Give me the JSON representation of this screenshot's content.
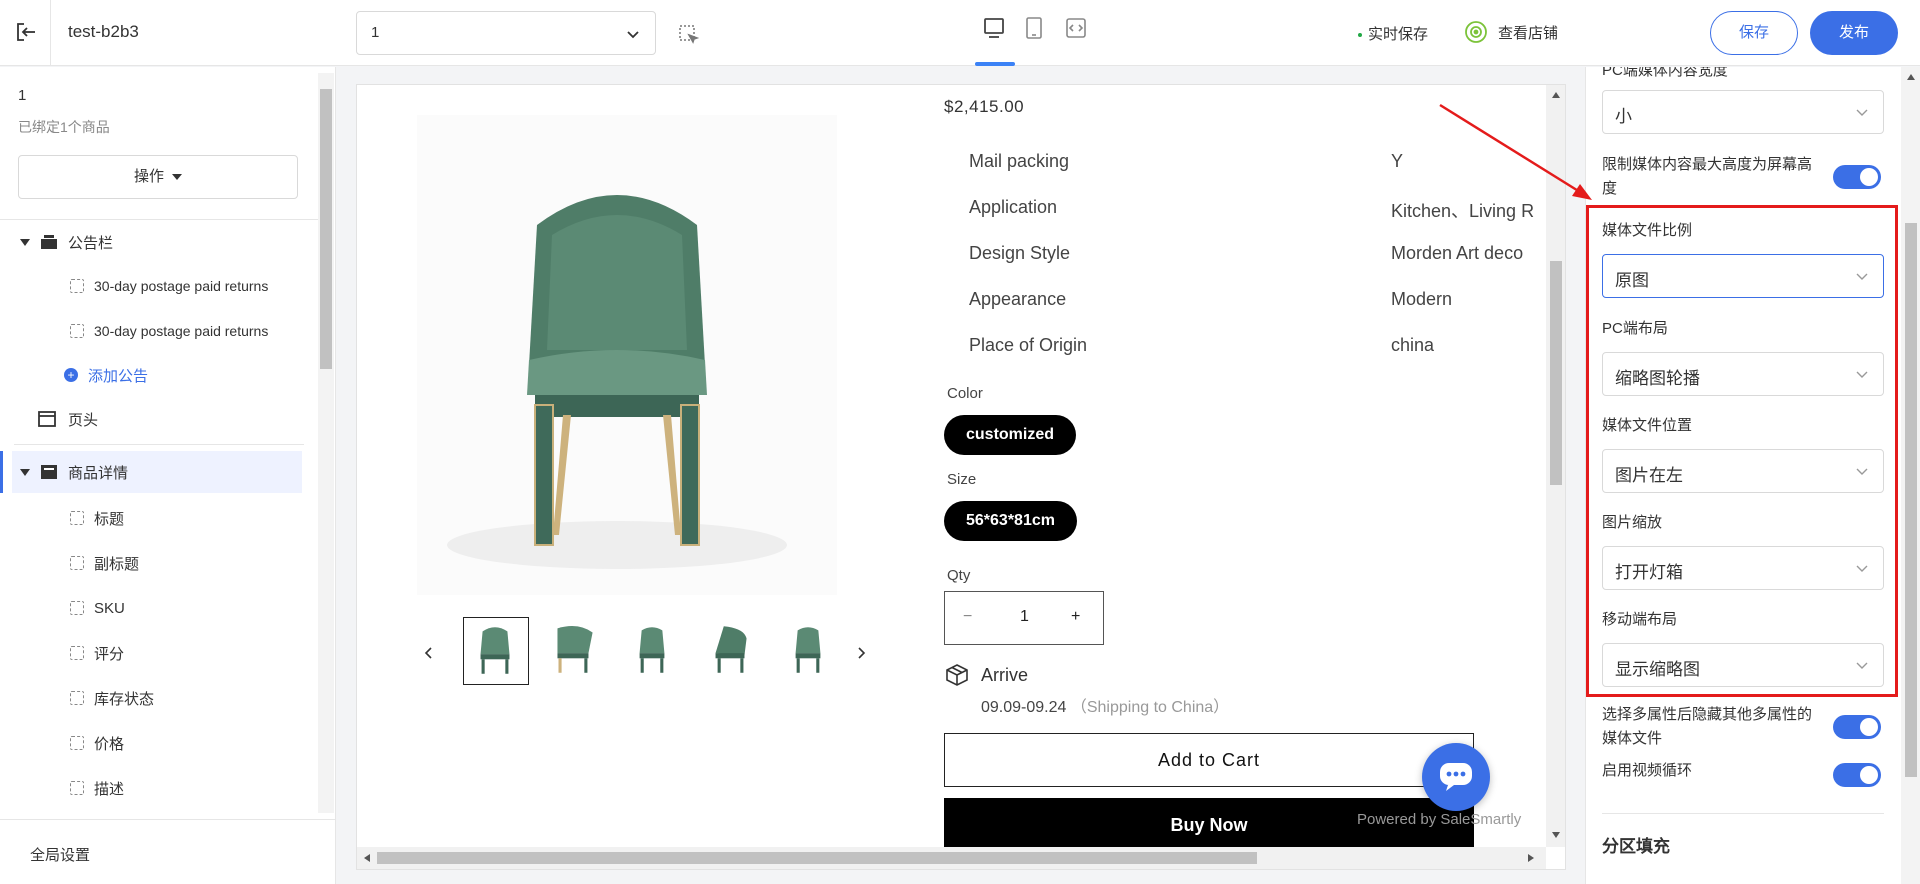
{
  "topbar": {
    "store_name": "test-b2b3",
    "page_select": "1",
    "autosave": "实时保存",
    "view_store": "查看店铺",
    "save": "保存",
    "publish": "发布"
  },
  "left": {
    "title": "1",
    "subtitle": "已绑定1个商品",
    "op_button": "操作",
    "tree": [
      {
        "label": "公告栏"
      },
      {
        "label": "30-day postage paid returns"
      },
      {
        "label": "30-day postage paid returns"
      },
      {
        "label": "添加公告"
      },
      {
        "label": "页头"
      },
      {
        "label": "商品详情"
      },
      {
        "label": "标题"
      },
      {
        "label": "副标题"
      },
      {
        "label": "SKU"
      },
      {
        "label": "评分"
      },
      {
        "label": "库存状态"
      },
      {
        "label": "价格"
      },
      {
        "label": "描述"
      }
    ],
    "global_settings": "全局设置"
  },
  "product": {
    "price": "$2,415.00",
    "specs": [
      {
        "key": "Mail packing",
        "value": "Y"
      },
      {
        "key": "Application",
        "value": "Kitchen、Living R"
      },
      {
        "key": "Design Style",
        "value": "Morden Art deco"
      },
      {
        "key": "Appearance",
        "value": "Modern"
      },
      {
        "key": "Place of Origin",
        "value": "china"
      }
    ],
    "color_label": "Color",
    "color_value": "customized",
    "size_label": "Size",
    "size_value": "56*63*81cm",
    "qty_label": "Qty",
    "qty_minus": "−",
    "qty_value": "1",
    "qty_plus": "+",
    "arrive_label": "Arrive",
    "arrive_date": "09.09-09.24",
    "arrive_note": "（Shipping to China）",
    "add_to_cart": "Add to Cart",
    "buy_now": "Buy Now",
    "powered_by": "Powered by SaleSmartly"
  },
  "right": {
    "cut_label": "PC端媒体内容宽度",
    "width_value": "小",
    "limit_height_label": "限制媒体内容最大高度为屏幕高度",
    "ratio_label": "媒体文件比例",
    "ratio_value": "原图",
    "pc_layout_label": "PC端布局",
    "pc_layout_value": "缩略图轮播",
    "media_pos_label": "媒体文件位置",
    "media_pos_value": "图片在左",
    "zoom_label": "图片缩放",
    "zoom_value": "打开灯箱",
    "mobile_layout_label": "移动端布局",
    "mobile_layout_value": "显示缩略图",
    "hide_media_label": "选择多属性后隐藏其他多属性的媒体文件",
    "video_loop_label": "启用视频循环",
    "section_fill": "分区填充"
  },
  "colors": {
    "accent": "#3b6fe6",
    "highlight": "#e41b1b",
    "chair_green": "#5b8a74"
  }
}
